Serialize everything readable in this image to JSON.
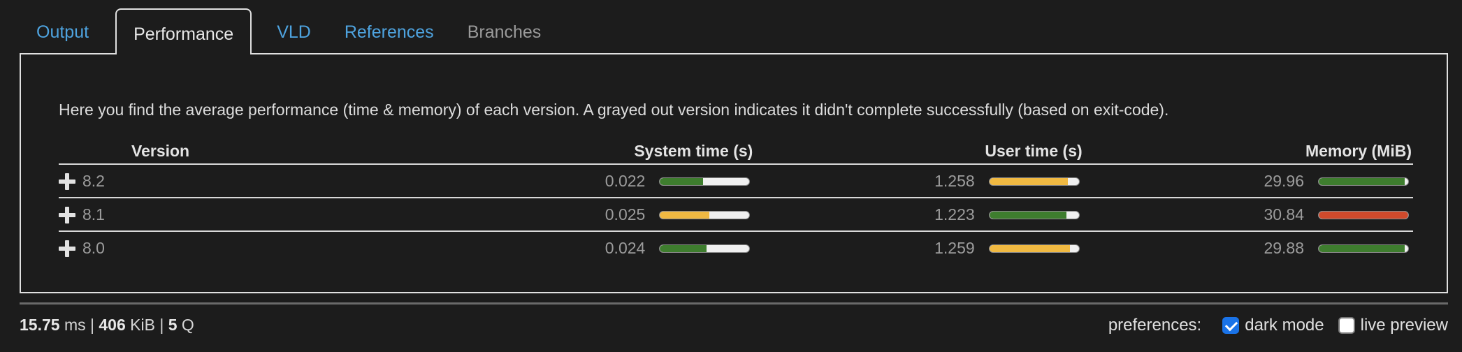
{
  "tabs": [
    {
      "label": "Output",
      "style": "link"
    },
    {
      "label": "Performance",
      "style": "active"
    },
    {
      "label": "VLD",
      "style": "link"
    },
    {
      "label": "References",
      "style": "link"
    },
    {
      "label": "Branches",
      "style": "muted"
    }
  ],
  "panel": {
    "intro": "Here you find the average performance (time & memory) of each version. A grayed out version indicates it didn't complete successfully (based on exit-code).",
    "headers": {
      "version": "Version",
      "system": "System time (s)",
      "user": "User time (s)",
      "memory": "Memory (MiB)"
    },
    "rows": [
      {
        "version": "8.2",
        "system": {
          "value": "0.022",
          "fill": 0.48,
          "color": "#3e7d2e"
        },
        "user": {
          "value": "1.258",
          "fill": 0.88,
          "color": "#f0b942"
        },
        "memory": {
          "value": "29.96",
          "fill": 0.96,
          "color": "#3e7d2e"
        }
      },
      {
        "version": "8.1",
        "system": {
          "value": "0.025",
          "fill": 0.55,
          "color": "#f0b942"
        },
        "user": {
          "value": "1.223",
          "fill": 0.86,
          "color": "#3e7d2e"
        },
        "memory": {
          "value": "30.84",
          "fill": 1.0,
          "color": "#d04a2c"
        }
      },
      {
        "version": "8.0",
        "system": {
          "value": "0.024",
          "fill": 0.52,
          "color": "#3e7d2e"
        },
        "user": {
          "value": "1.259",
          "fill": 0.9,
          "color": "#f0b942"
        },
        "memory": {
          "value": "29.88",
          "fill": 0.96,
          "color": "#3e7d2e"
        }
      }
    ]
  },
  "status": {
    "time": "15.75",
    "time_unit": "ms",
    "memory": "406",
    "memory_unit": "KiB",
    "queries": "5",
    "queries_unit": "Q",
    "separator": "|"
  },
  "preferences": {
    "label": "preferences:",
    "options": [
      {
        "label": "dark mode",
        "checked": true
      },
      {
        "label": "live preview",
        "checked": false
      }
    ]
  }
}
